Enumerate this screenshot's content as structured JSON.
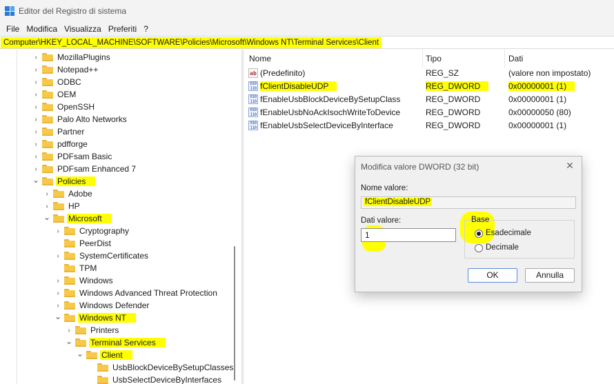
{
  "window": {
    "title": "Editor del Registro di sistema"
  },
  "menu": [
    "File",
    "Modifica",
    "Visualizza",
    "Preferiti",
    "?"
  ],
  "address": "Computer\\HKEY_LOCAL_MACHINE\\SOFTWARE\\Policies\\Microsoft\\Windows NT\\Terminal Services\\Client",
  "tree": [
    {
      "label": "MozillaPlugins",
      "level": 0,
      "expanded": false,
      "highlight": false
    },
    {
      "label": "Notepad++",
      "level": 0,
      "expanded": false,
      "highlight": false
    },
    {
      "label": "ODBC",
      "level": 0,
      "expanded": false,
      "highlight": false
    },
    {
      "label": "OEM",
      "level": 0,
      "expanded": false,
      "highlight": false
    },
    {
      "label": "OpenSSH",
      "level": 0,
      "expanded": false,
      "highlight": false
    },
    {
      "label": "Palo Alto Networks",
      "level": 0,
      "expanded": false,
      "highlight": false
    },
    {
      "label": "Partner",
      "level": 0,
      "expanded": false,
      "highlight": false
    },
    {
      "label": "pdfforge",
      "level": 0,
      "expanded": false,
      "highlight": false
    },
    {
      "label": "PDFsam Basic",
      "level": 0,
      "expanded": false,
      "highlight": false
    },
    {
      "label": "PDFsam Enhanced 7",
      "level": 0,
      "expanded": false,
      "highlight": false
    },
    {
      "label": "Policies",
      "level": 0,
      "expanded": true,
      "highlight": true
    },
    {
      "label": "Adobe",
      "level": 1,
      "expanded": false,
      "highlight": false
    },
    {
      "label": "HP",
      "level": 1,
      "expanded": false,
      "highlight": false
    },
    {
      "label": "Microsoft",
      "level": 1,
      "expanded": true,
      "highlight": true
    },
    {
      "label": "Cryptography",
      "level": 2,
      "expanded": false,
      "highlight": false
    },
    {
      "label": "PeerDist",
      "level": 2,
      "expanded": null,
      "highlight": false
    },
    {
      "label": "SystemCertificates",
      "level": 2,
      "expanded": false,
      "highlight": false
    },
    {
      "label": "TPM",
      "level": 2,
      "expanded": null,
      "highlight": false
    },
    {
      "label": "Windows",
      "level": 2,
      "expanded": false,
      "highlight": false
    },
    {
      "label": "Windows Advanced Threat Protection",
      "level": 2,
      "expanded": false,
      "highlight": false
    },
    {
      "label": "Windows Defender",
      "level": 2,
      "expanded": false,
      "highlight": false
    },
    {
      "label": "Windows NT",
      "level": 2,
      "expanded": true,
      "highlight": true
    },
    {
      "label": "Printers",
      "level": 3,
      "expanded": false,
      "highlight": false
    },
    {
      "label": "Terminal Services",
      "level": 3,
      "expanded": true,
      "highlight": true
    },
    {
      "label": "Client",
      "level": 4,
      "expanded": true,
      "highlight": true,
      "selected": true
    },
    {
      "label": "UsbBlockDeviceBySetupClasses",
      "level": 5,
      "expanded": null,
      "highlight": false
    },
    {
      "label": "UsbSelectDeviceByInterfaces",
      "level": 5,
      "expanded": null,
      "highlight": false
    }
  ],
  "list": {
    "columns": [
      "Nome",
      "Tipo",
      "Dati"
    ],
    "rows": [
      {
        "icon": "string-value-icon",
        "name": "(Predefinito)",
        "type": "REG_SZ",
        "data": "(valore non impostato)",
        "highlight": false
      },
      {
        "icon": "dword-value-icon",
        "name": "fClientDisableUDP",
        "type": "REG_DWORD",
        "data": "0x00000001 (1)",
        "highlight": true
      },
      {
        "icon": "dword-value-icon",
        "name": "fEnableUsbBlockDeviceBySetupClass",
        "type": "REG_DWORD",
        "data": "0x00000001 (1)",
        "highlight": false
      },
      {
        "icon": "dword-value-icon",
        "name": "fEnableUsbNoAckIsochWriteToDevice",
        "type": "REG_DWORD",
        "data": "0x00000050 (80)",
        "highlight": false
      },
      {
        "icon": "dword-value-icon",
        "name": "fEnableUsbSelectDeviceByInterface",
        "type": "REG_DWORD",
        "data": "0x00000001 (1)",
        "highlight": false
      }
    ]
  },
  "dialog": {
    "title": "Modifica valore DWORD (32 bit)",
    "name_label": "Nome valore:",
    "name_value": "fClientDisableUDP",
    "data_label": "Dati valore:",
    "data_value": "1",
    "base_label": "Base",
    "base_options": [
      "Esadecimale",
      "Decimale"
    ],
    "base_selected": "Esadecimale",
    "ok": "OK",
    "cancel": "Annulla"
  }
}
